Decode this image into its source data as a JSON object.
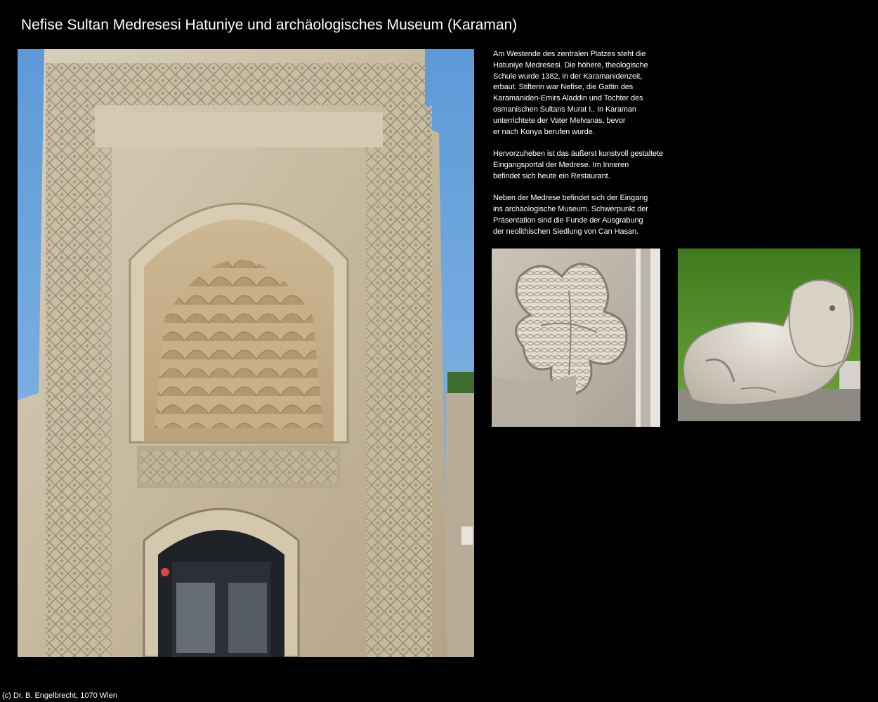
{
  "page": {
    "title": "Nefise Sultan Medresesi Hatuniye und archäologisches Museum (Karaman)",
    "footer": "(c) Dr. B. Engelbrecht, 1070 Wien"
  },
  "description": {
    "paragraphs": [
      {
        "lines": [
          "Am Westende des zentralen Platzes steht die",
          "Hatuniye Medresesi. Die höhere, theologische",
          "Schule wurde 1382, in der Karamanidenzeit,",
          "erbaut. Stifterin war Nefise, die Gattin des",
          "Karamaniden-Emirs Aladdin und Tochter des",
          "osmanischen Sultans Murat I.. In Karaman",
          "unterrichtete der Vater Melvanas, bevor",
          "er nach Konya berufen wurde."
        ]
      },
      {
        "lines": [
          "Hervorzuheben ist das äußerst kunstvoll gestaltete",
          "Eingangsportal der Medrese. Im Inneren",
          "befindet sich heute ein Restaurant."
        ]
      },
      {
        "lines": [
          "Neben der Medrese befindet sich der Eingang",
          "ins archäologische Museum. Schwerpunkt der",
          "Präsentation sind die Funde der Ausgrabung",
          "der neolithischen Siedlung von Can Hasan."
        ]
      }
    ]
  },
  "colors": {
    "background": "#000000",
    "text": "#ffffff",
    "sky": "#6fa7dc",
    "stone": "#cfc3ad",
    "grass": "#4f8a2a"
  }
}
